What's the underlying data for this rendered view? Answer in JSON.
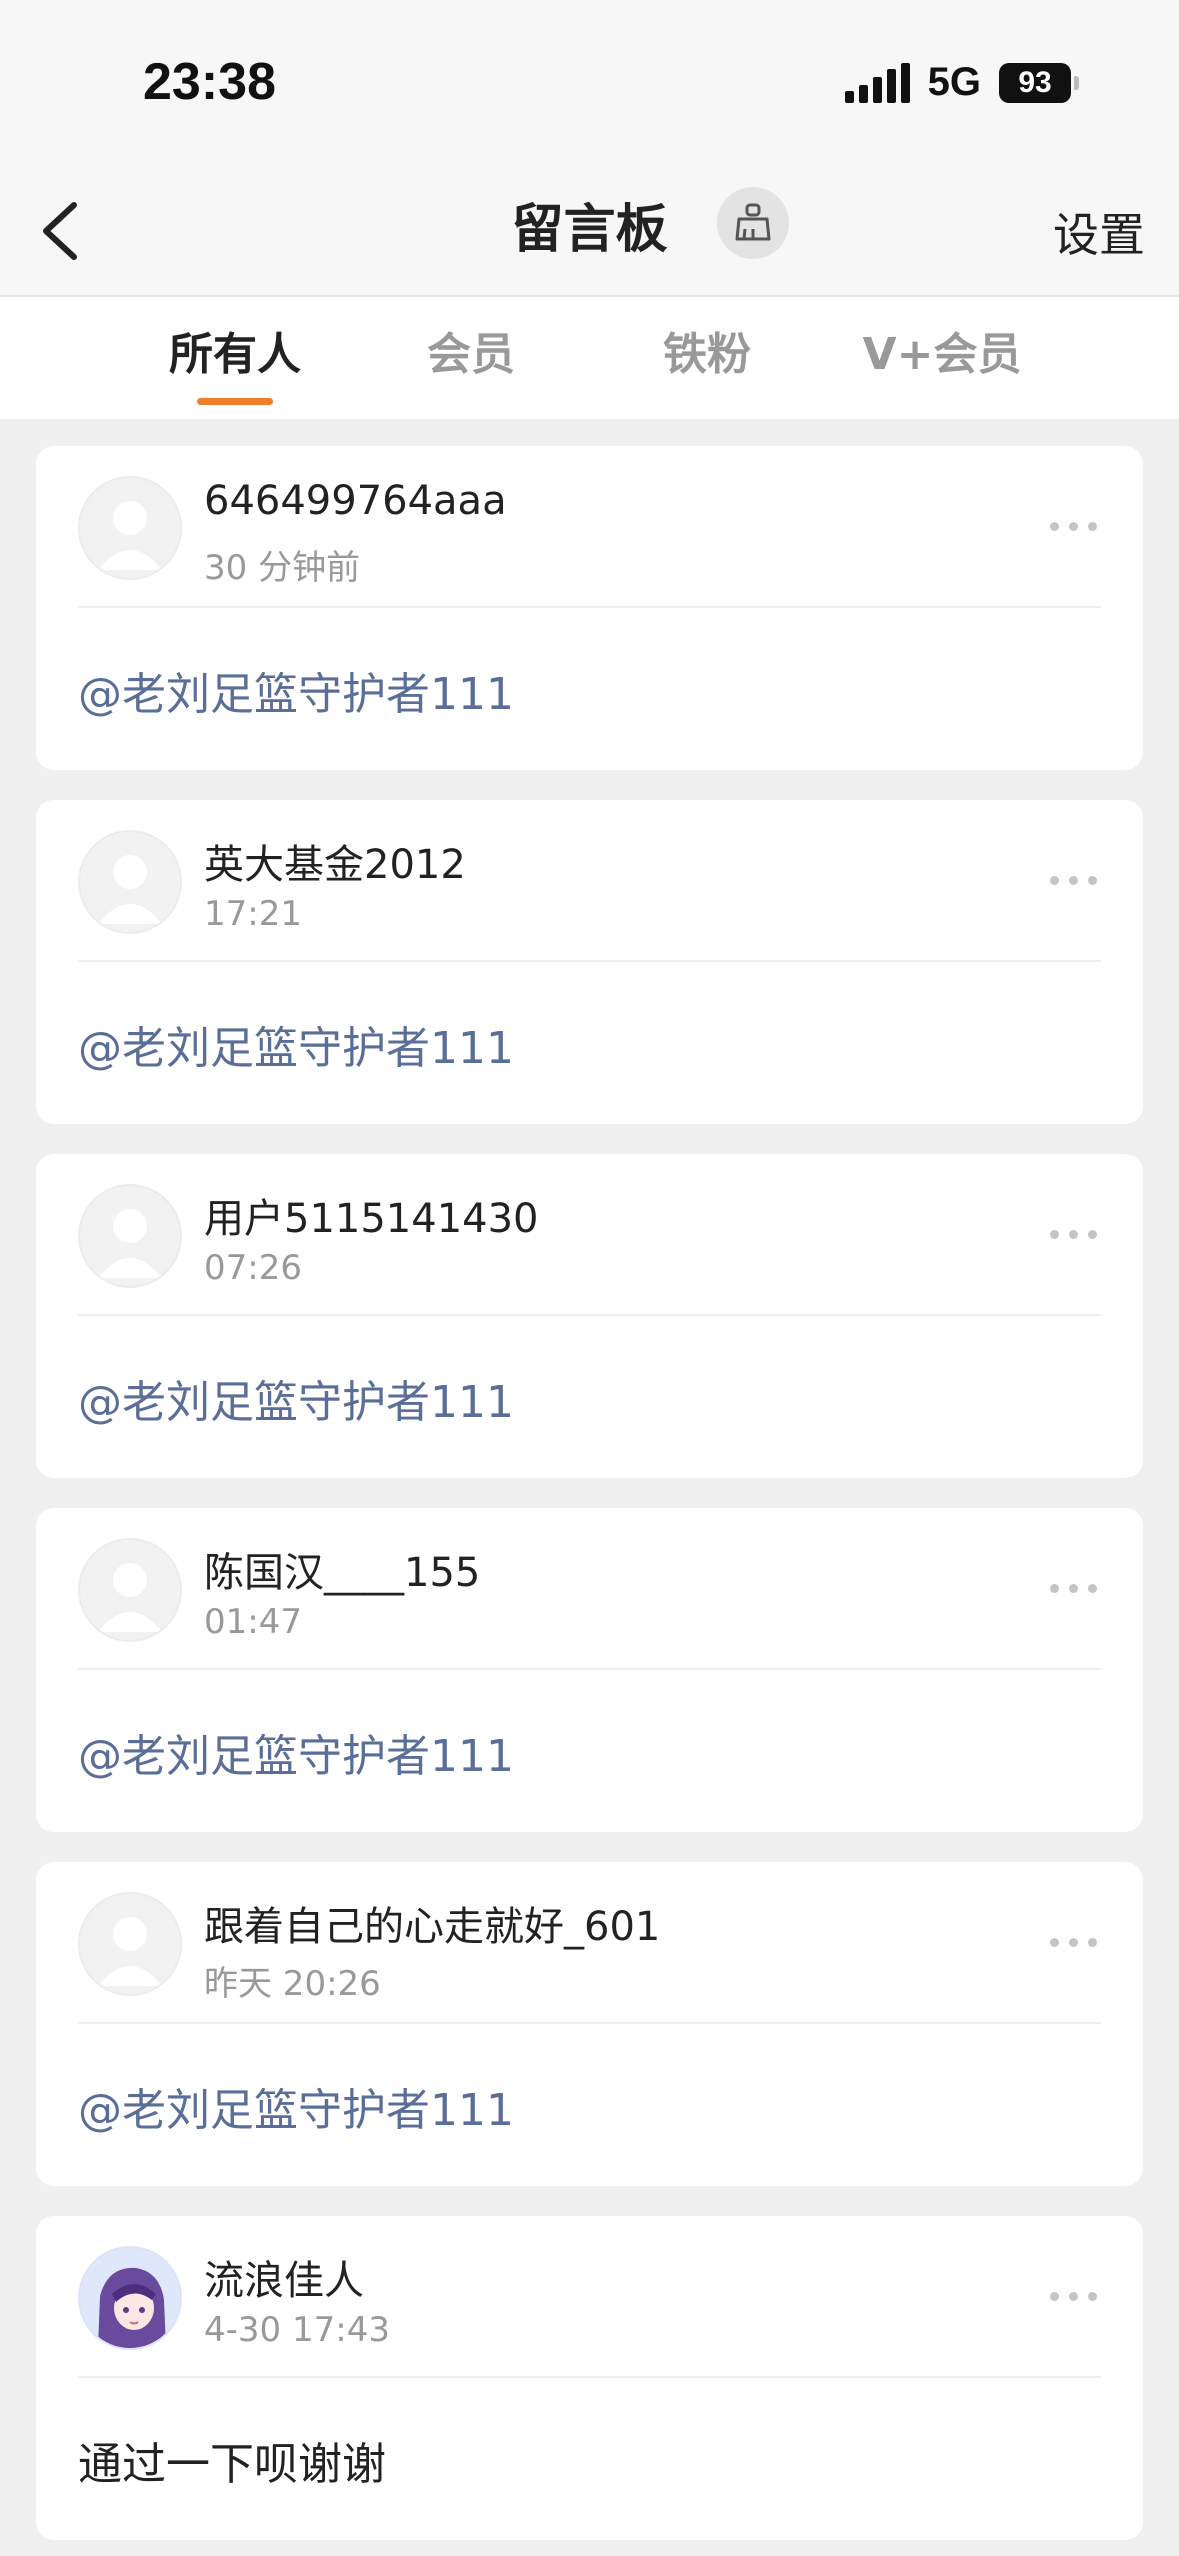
{
  "status_bar": {
    "time": "23:38",
    "network": "5G",
    "battery": "93"
  },
  "nav": {
    "title": "留言板",
    "settings_label": "设置",
    "back_icon": "chevron-left-icon",
    "clean_icon": "broom-icon"
  },
  "tabs": [
    {
      "label": "所有人",
      "active": true
    },
    {
      "label": "会员",
      "active": false
    },
    {
      "label": "铁粉",
      "active": false
    },
    {
      "label": "V+会员",
      "active": false
    }
  ],
  "accent_color": "#f07d2a",
  "mention_color": "#5a6e98",
  "messages": [
    {
      "username": "646499764aaa",
      "time": "30 分钟前",
      "content": "@老刘足篮守护者111",
      "is_mention": true,
      "avatar": "default-avatar"
    },
    {
      "username": "英大基金2012",
      "time": "17:21",
      "content": "@老刘足篮守护者111",
      "is_mention": true,
      "avatar": "default-avatar"
    },
    {
      "username": "用户5115141430",
      "time": "07:26",
      "content": "@老刘足篮守护者111",
      "is_mention": true,
      "avatar": "default-avatar"
    },
    {
      "username": "陈国汉____155",
      "time": "01:47",
      "content": "@老刘足篮守护者111",
      "is_mention": true,
      "avatar": "default-avatar"
    },
    {
      "username": "跟着自己的心走就好_601",
      "time": "昨天 20:26",
      "content": "@老刘足篮守护者111",
      "is_mention": true,
      "avatar": "default-avatar"
    },
    {
      "username": "流浪佳人",
      "time": "4-30 17:43",
      "content": "通过一下呗谢谢",
      "is_mention": false,
      "avatar": "anime-avatar"
    }
  ]
}
